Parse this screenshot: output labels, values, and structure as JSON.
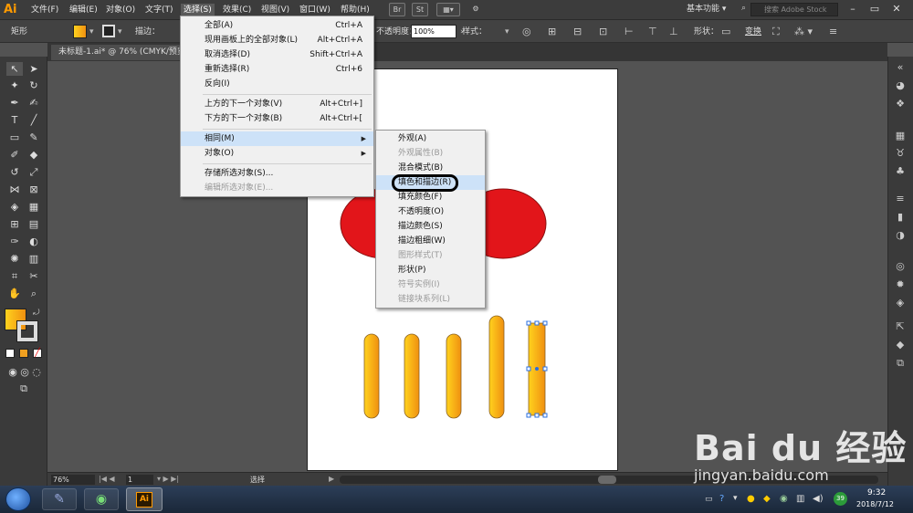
{
  "app": {
    "logo_text": "Ai",
    "accent": "#ff9a00"
  },
  "menubar": {
    "items": [
      "文件(F)",
      "编辑(E)",
      "对象(O)",
      "文字(T)",
      "选择(S)",
      "效果(C)",
      "视图(V)",
      "窗口(W)",
      "帮助(H)"
    ],
    "active": "选择(S)",
    "bridge_label": "Br",
    "stock_label": "St",
    "workspace": "基本功能",
    "search_placeholder": "搜索 Adobe Stock"
  },
  "control_bar": {
    "selection_label": "矩形",
    "stroke_label": "描边：",
    "opacity_label": "不透明度：",
    "opacity_value": "100%",
    "style_label": "样式：",
    "shape_label": "形状：",
    "transform_label": "变换"
  },
  "document": {
    "tab_title": "未标题-1.ai* @ 76% (CMYK/预览)"
  },
  "select_menu": {
    "items": [
      {
        "label": "全部(A)",
        "shortcut": "Ctrl+A",
        "disabled": false
      },
      {
        "label": "现用画板上的全部对象(L)",
        "shortcut": "Alt+Ctrl+A",
        "disabled": false
      },
      {
        "label": "取消选择(D)",
        "shortcut": "Shift+Ctrl+A",
        "disabled": false
      },
      {
        "label": "重新选择(R)",
        "shortcut": "Ctrl+6",
        "disabled": false
      },
      {
        "label": "反向(I)",
        "shortcut": "",
        "disabled": false
      },
      {
        "label": "上方的下一个对象(V)",
        "shortcut": "Alt+Ctrl+]",
        "disabled": false
      },
      {
        "label": "下方的下一个对象(B)",
        "shortcut": "Alt+Ctrl+[",
        "disabled": false
      },
      {
        "label": "相同(M)",
        "shortcut": "",
        "disabled": false,
        "submenu": true
      },
      {
        "label": "对象(O)",
        "shortcut": "",
        "disabled": false,
        "submenu": true
      },
      {
        "label": "存储所选对象(S)...",
        "shortcut": "",
        "disabled": false
      },
      {
        "label": "编辑所选对象(E)...",
        "shortcut": "",
        "disabled": true
      }
    ]
  },
  "same_submenu": {
    "items": [
      {
        "label": "外观(A)",
        "disabled": false
      },
      {
        "label": "外观属性(B)",
        "disabled": true
      },
      {
        "label": "混合模式(B)",
        "disabled": false
      },
      {
        "label": "填色和描边(R)",
        "disabled": false,
        "highlighted": true
      },
      {
        "label": "填充颜色(F)",
        "disabled": false
      },
      {
        "label": "不透明度(O)",
        "disabled": false
      },
      {
        "label": "描边颜色(S)",
        "disabled": false
      },
      {
        "label": "描边粗细(W)",
        "disabled": false
      },
      {
        "label": "图形样式(T)",
        "disabled": true
      },
      {
        "label": "形状(P)",
        "disabled": false
      },
      {
        "label": "符号实例(I)",
        "disabled": true
      },
      {
        "label": "链接块系列(L)",
        "disabled": true
      }
    ]
  },
  "status": {
    "zoom": "76%",
    "page": "1",
    "tool_status": "选择"
  },
  "taskbar": {
    "time": "9:32",
    "date": "2018/7/12",
    "app_label": "Ai",
    "badge": "39"
  },
  "colors": {
    "red_shape": "#e2151a",
    "gradient_start": "#ffd21e",
    "gradient_end": "#f09010"
  },
  "watermark": {
    "brand": "Bai du 经验",
    "url": "jingyan.baidu.com"
  }
}
